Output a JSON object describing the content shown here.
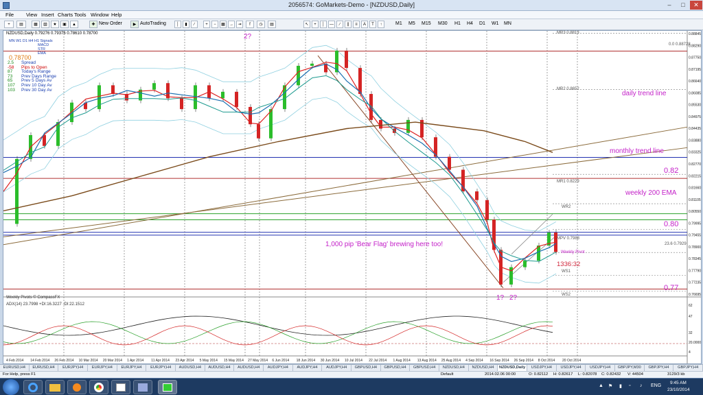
{
  "window": {
    "title": "2056574: GoMarkets-Demo - [NZDUSD,Daily]",
    "controls": [
      "–",
      "□",
      "✕"
    ]
  },
  "menu": [
    "File",
    "View",
    "Insert",
    "Charts",
    "Tools",
    "Window",
    "Help"
  ],
  "toolbar": {
    "new_order": "New Order",
    "autotrading": "AutoTrading",
    "timeframes": [
      "M1",
      "M5",
      "M15",
      "M30",
      "H1",
      "H4",
      "D1",
      "W1",
      "MN"
    ]
  },
  "chart": {
    "header": "NZDUSD,Daily  0.79276 0.79376 0.78610 0.78700",
    "info_legend": [
      "MN W1 D1 H4 H1  Signals",
      "MACD",
      "STR",
      "EMA"
    ],
    "price_big": "0.78700",
    "info": [
      [
        "2.5",
        "Spread"
      ],
      [
        "-58",
        "Pips to Open"
      ],
      [
        "87",
        "Today's Range"
      ],
      [
        "73",
        "Prev Days Range"
      ],
      [
        "65",
        "Prev 5 Days Av"
      ],
      [
        "107",
        "Prev 10 Day Av"
      ],
      [
        "103",
        "Prev 30 Day Av"
      ]
    ],
    "annotations": {
      "q1": "2?",
      "daily_trend": "daily trend line",
      "monthly_trend": "monthly trend line",
      "weekly_ema": "weekly 200 EMA",
      "p082": "0.82",
      "p080": "0.80",
      "p077": "0.77",
      "bear_flag": "1,000 pip 'Bear Flag' brewing here too!",
      "count": "1336:32",
      "q2": "1?",
      "q3": "2?"
    },
    "pivots": {
      "mr3": "MR3  0.8813",
      "mr2": "MR2  0.8652",
      "mr1": "MR1  0.8229",
      "mpv": "MPV  0.7988",
      "fib": "0.0  0.88728",
      "fib2": "23.6  0.7929",
      "wr2": "WR2",
      "wpivot": "Weekly Pivot",
      "ws1": "WS1",
      "ws2": "WS2"
    },
    "weekly_pivots_label": "Weekly Pivots  © CompassFX",
    "adx_label": "ADX(14) 23.7998 +DI:16.3227 -DI:22.1512",
    "price_axis": [
      "0.88845",
      "0.88290",
      "0.87750",
      "0.87195",
      "0.86640",
      "0.86085",
      "0.85530",
      "0.84975",
      "0.84435",
      "0.83880",
      "0.83325",
      "0.82770",
      "0.82215",
      "0.81660",
      "0.81105",
      "0.80550",
      "0.79995",
      "0.79455",
      "0.78900",
      "0.78345",
      "0.77790",
      "0.77235",
      "0.76695"
    ],
    "adx_axis": [
      "62",
      "47",
      "32",
      "20.0000",
      "4"
    ],
    "date_axis": [
      "4 Feb 2014",
      "14 Feb 2014",
      "26 Feb 2014",
      "10 Mar 2014",
      "20 Mar 2014",
      "1 Apr 2014",
      "11 Apr 2014",
      "23 Apr 2014",
      "5 May 2014",
      "15 May 2014",
      "27 May 2014",
      "6 Jun 2014",
      "18 Jun 2014",
      "30 Jun 2014",
      "10 Jul 2014",
      "22 Jul 2014",
      "1 Aug 2014",
      "13 Aug 2014",
      "25 Aug 2014",
      "4 Sep 2014",
      "16 Sep 2014",
      "26 Sep 2014",
      "8 Oct 2014",
      "20 Oct 2014"
    ]
  },
  "tabs": [
    "EURUSD,H4",
    "EURUSD,H4",
    "EURJPY,H4",
    "EURJPY,H4",
    "EURJPY,H4",
    "EURJPY,H4",
    "AUDUSD,H4",
    "AUDUSD,H4",
    "AUDUSD,H4",
    "AUDJPY,H4",
    "AUDJPY,H4",
    "AUDJPY,H4",
    "GBPUSD,H4",
    "GBPUSD,H4",
    "GBPUSD,H4",
    "NZDUSD,H4",
    "NZDUSD,H4",
    "NZDUSD,Daily",
    "USDJPY,H4",
    "USDJPY,H4",
    "USDJPY,H4",
    "GBPJPY,M30",
    "GBPJPY,H4",
    "GBPJPY,H4"
  ],
  "status": {
    "help": "For Help, press F1",
    "profile": "Default",
    "datetime": "2014.02.06 00:00",
    "o": "O: 0.82112",
    "h": "H: 0.82617",
    "l": "L: 0.82078",
    "c": "C: 0.82432",
    "v": "V: 44504",
    "conn": "3129/3 kb"
  },
  "taskbar": {
    "time": "9:45 AM",
    "date": "23/10/2014",
    "lang": "ENG"
  }
}
